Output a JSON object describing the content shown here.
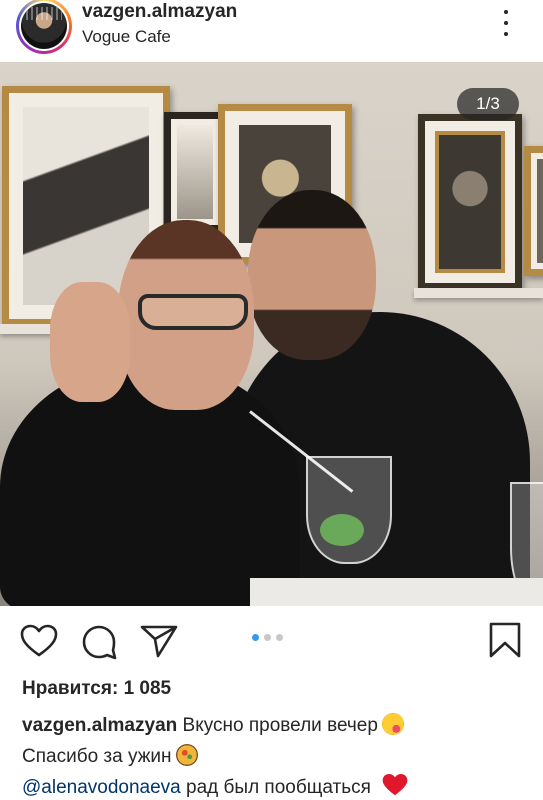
{
  "header": {
    "username": "vazgen.almazyan",
    "location": "Vogue Cafe",
    "more_icon": "more-vertical-icon"
  },
  "photo": {
    "counter": "1/3"
  },
  "actions": {
    "icons": [
      "heart-icon",
      "comment-icon",
      "share-icon",
      "bookmark-icon"
    ],
    "carousel_pages": 3,
    "carousel_active": 1,
    "accent_color": "#3897f0"
  },
  "likes": {
    "text": "Нравится: 1 085"
  },
  "caption": {
    "username": "vazgen.almazyan",
    "line1_text": " Вкусно провели вечер",
    "line2_text": "Спасибо за ужин",
    "mention": "@alenavodonaeva",
    "line3_text": " рад был пообщаться",
    "emojis": [
      "face-savoring-food-emoji",
      "paella-emoji",
      "red-heart-emoji"
    ]
  }
}
